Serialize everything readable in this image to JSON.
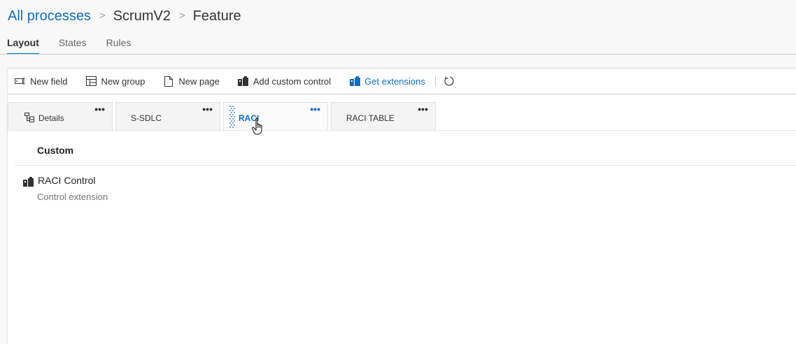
{
  "breadcrumb": {
    "items": [
      "All processes",
      "ScrumV2",
      "Feature"
    ],
    "separator": ">"
  },
  "tabs": [
    {
      "label": "Layout",
      "active": true
    },
    {
      "label": "States",
      "active": false
    },
    {
      "label": "Rules",
      "active": false
    }
  ],
  "toolbar": {
    "new_field": {
      "label": "New field",
      "icon": "new-field-icon"
    },
    "new_group": {
      "label": "New group",
      "icon": "new-group-icon"
    },
    "new_page": {
      "label": "New page",
      "icon": "new-page-icon"
    },
    "add_custom_control": {
      "label": "Add custom control",
      "icon": "custom-control-icon"
    },
    "get_extensions": {
      "label": "Get extensions",
      "icon": "extensions-icon"
    },
    "refresh": {
      "icon": "refresh-icon"
    }
  },
  "pages": [
    {
      "label": "Details",
      "icon": "details-icon",
      "active": false,
      "more": "•••"
    },
    {
      "label": "S-SDLC",
      "active": false,
      "more": "•••"
    },
    {
      "label": "RACI",
      "active": true,
      "more": "•••"
    },
    {
      "label": "RACI TABLE",
      "active": false,
      "more": "•••"
    }
  ],
  "group": {
    "title": "Custom",
    "control": {
      "name": "RACI Control",
      "description": "Control extension",
      "icon": "extension-control-icon"
    }
  },
  "colors": {
    "accent": "#0078d4",
    "link": "#106ebe",
    "background": "#f8f8f8"
  }
}
